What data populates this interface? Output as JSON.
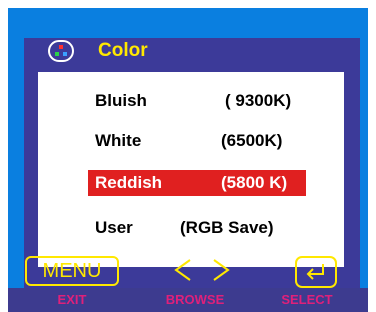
{
  "menu": {
    "title": "Color",
    "items": [
      {
        "name": "Bluish",
        "value": "( 9300K)"
      },
      {
        "name": "White",
        "value": "(6500K)"
      },
      {
        "name": "Reddish",
        "value": "(5800 K)"
      },
      {
        "name": "User",
        "value": "(RGB  Save)"
      }
    ],
    "selected_index": 2
  },
  "buttons": {
    "menu_label": "MENU",
    "exit_label": "EXIT",
    "browse_label": "BROWSE",
    "select_label": "SELECT"
  },
  "icons": {
    "title": "color-rgb-icon",
    "browse": "left-right-arrows-icon",
    "select": "enter-icon"
  },
  "colors": {
    "accent_yellow": "#ffe800",
    "selection_red": "#e02020",
    "label_pink": "#e0207a",
    "panel_blue": "#3c3a99",
    "bezel_blue": "#0a7fe0"
  }
}
